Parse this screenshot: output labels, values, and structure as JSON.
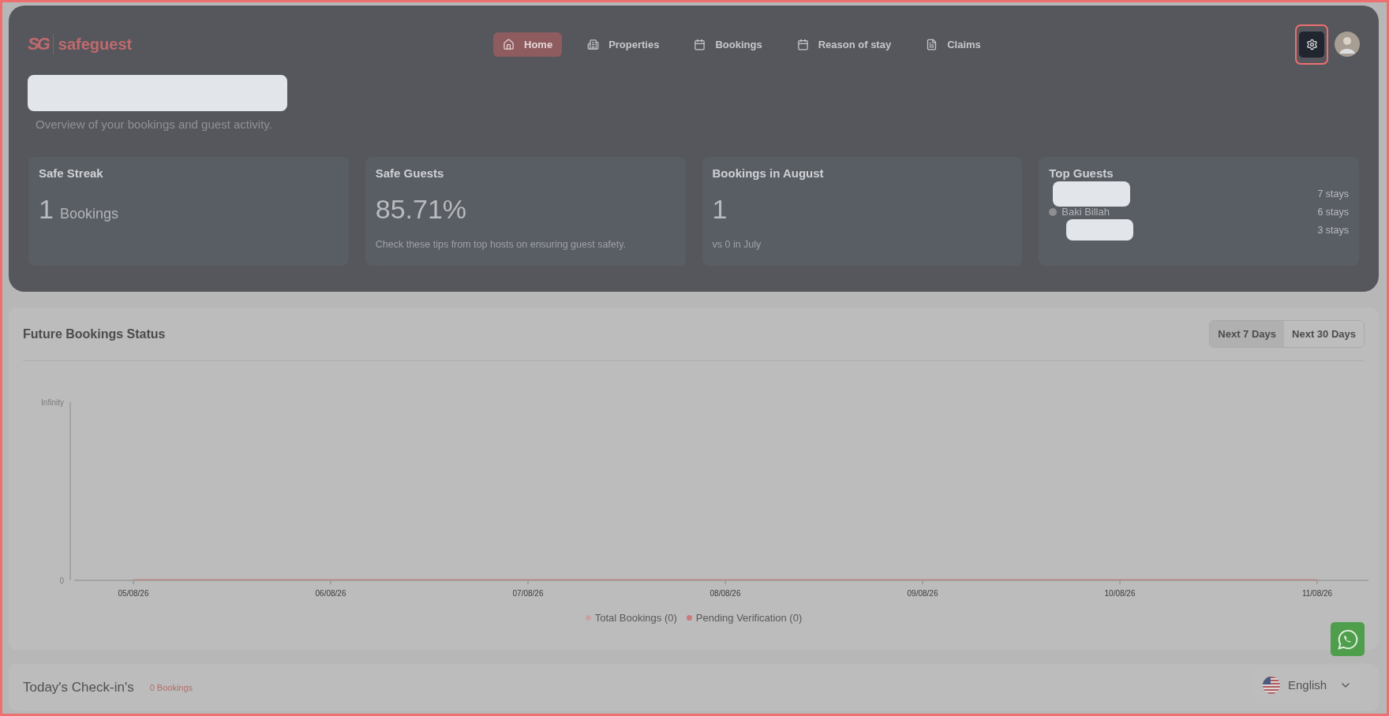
{
  "brand": {
    "logo_mark": "SG",
    "name": "safeguest"
  },
  "nav": [
    {
      "label": "Home",
      "selected": true
    },
    {
      "label": "Properties",
      "selected": false
    },
    {
      "label": "Bookings",
      "selected": false
    },
    {
      "label": "Reason of stay",
      "selected": false
    },
    {
      "label": "Claims",
      "selected": false
    }
  ],
  "header": {
    "subtitle": "Overview of your bookings and guest activity."
  },
  "stats": [
    {
      "kind": "count",
      "title": "Safe Streak",
      "value": "1",
      "unit": "Bookings"
    },
    {
      "kind": "note",
      "title": "Safe Guests",
      "value": "85.71%",
      "note": "Check these tips from top hosts on ensuring guest safety."
    },
    {
      "kind": "note",
      "title": "Bookings in August",
      "value": "1",
      "note": "vs 0 in July"
    },
    {
      "kind": "guests",
      "title": "Top Guests",
      "guests": [
        {
          "kind": "redacted",
          "stays": "7 stays"
        },
        {
          "kind": "named",
          "name": "Baki Billah",
          "stays": "6 stays"
        },
        {
          "kind": "redacted",
          "stays": "3 stays"
        }
      ]
    }
  ],
  "future_bookings": {
    "title": "Future Bookings Status",
    "y_axis_labels": [
      "Infinity",
      "0"
    ],
    "ranges": [
      {
        "label": "Next 7 Days",
        "selected": true
      },
      {
        "label": "Next 30 Days",
        "selected": false
      }
    ],
    "x_axis_labels": [
      "05/08/26",
      "06/08/26",
      "07/08/26",
      "08/08/26",
      "09/08/26",
      "10/08/26",
      "11/08/26"
    ],
    "legend": [
      {
        "label": "Total Bookings (0)",
        "color": "#c9a3a3"
      },
      {
        "label": "Pending Verification (0)",
        "color": "#c97a7a"
      }
    ]
  },
  "checkins": {
    "title": "Today's Check-in's",
    "count": "0 Bookings"
  },
  "language": {
    "label": "English"
  }
}
